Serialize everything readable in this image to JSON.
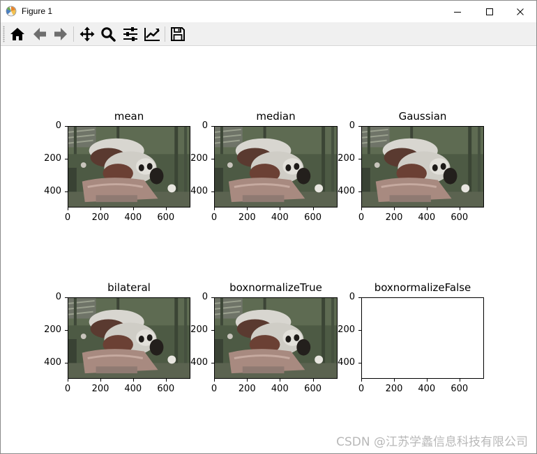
{
  "window": {
    "title": "Figure 1",
    "icon": "matplotlib-icon",
    "controls": [
      "minimize-icon",
      "maximize-icon",
      "close-icon"
    ]
  },
  "toolbar": {
    "buttons": [
      "home-icon",
      "back-arrow-icon",
      "forward-arrow-icon",
      "pan-icon",
      "zoom-icon",
      "subplots-config-icon",
      "edit-axes-icon",
      "save-icon"
    ]
  },
  "figure": {
    "subplots": [
      {
        "title": "mean",
        "yticks": [
          "0",
          "200",
          "400"
        ],
        "xticks": [
          "0",
          "200",
          "400",
          "600"
        ],
        "image": "panda-photo"
      },
      {
        "title": "median",
        "yticks": [
          "0",
          "200",
          "400"
        ],
        "xticks": [
          "0",
          "200",
          "400",
          "600"
        ],
        "image": "panda-photo"
      },
      {
        "title": "Gaussian",
        "yticks": [
          "0",
          "200",
          "400"
        ],
        "xticks": [
          "0",
          "200",
          "400",
          "600"
        ],
        "image": "panda-photo"
      },
      {
        "title": "bilateral",
        "yticks": [
          "0",
          "200",
          "400"
        ],
        "xticks": [
          "0",
          "200",
          "400",
          "600"
        ],
        "image": "panda-photo"
      },
      {
        "title": "boxnormalizeTrue",
        "yticks": [
          "0",
          "200",
          "400"
        ],
        "xticks": [
          "0",
          "200",
          "400",
          "600"
        ],
        "image": "panda-photo"
      },
      {
        "title": "boxnormalizeFalse",
        "yticks": [
          "0",
          "200",
          "400"
        ],
        "xticks": [
          "0",
          "200",
          "400",
          "600"
        ],
        "image": "white-blank"
      }
    ]
  },
  "watermark": "CSDN @江苏学蠡信息科技有限公司"
}
